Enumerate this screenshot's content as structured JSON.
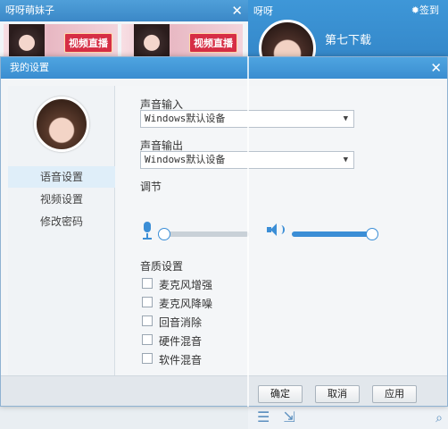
{
  "bg_left": {
    "title": "呀呀萌妹子",
    "thumb_tag": "视频直播"
  },
  "bg_right": {
    "title": "呀呀",
    "sign_in": "签到",
    "username": "第七下载"
  },
  "dialog": {
    "title": "我的设置",
    "nav": [
      {
        "label": "语音设置",
        "active": true
      },
      {
        "label": "视频设置",
        "active": false
      },
      {
        "label": "修改密码",
        "active": false
      }
    ],
    "audio_input_label": "声音输入",
    "audio_input_value": "Windows默认设备",
    "audio_output_label": "声音输出",
    "audio_output_value": "Windows默认设备",
    "adjust_label": "调节",
    "mic_volume": 0.0,
    "speaker_volume": 0.98,
    "quality_label": "音质设置",
    "quality_options": [
      {
        "label": "麦克风增强",
        "checked": false
      },
      {
        "label": "麦克风降噪",
        "checked": false
      },
      {
        "label": "回音消除",
        "checked": false
      },
      {
        "label": "硬件混音",
        "checked": false
      },
      {
        "label": "软件混音",
        "checked": false
      }
    ],
    "buttons": {
      "ok": "确定",
      "cancel": "取消",
      "apply": "应用"
    }
  },
  "colors": {
    "accent": "#3b8ed6",
    "titlebar": "#3a8dd0"
  }
}
